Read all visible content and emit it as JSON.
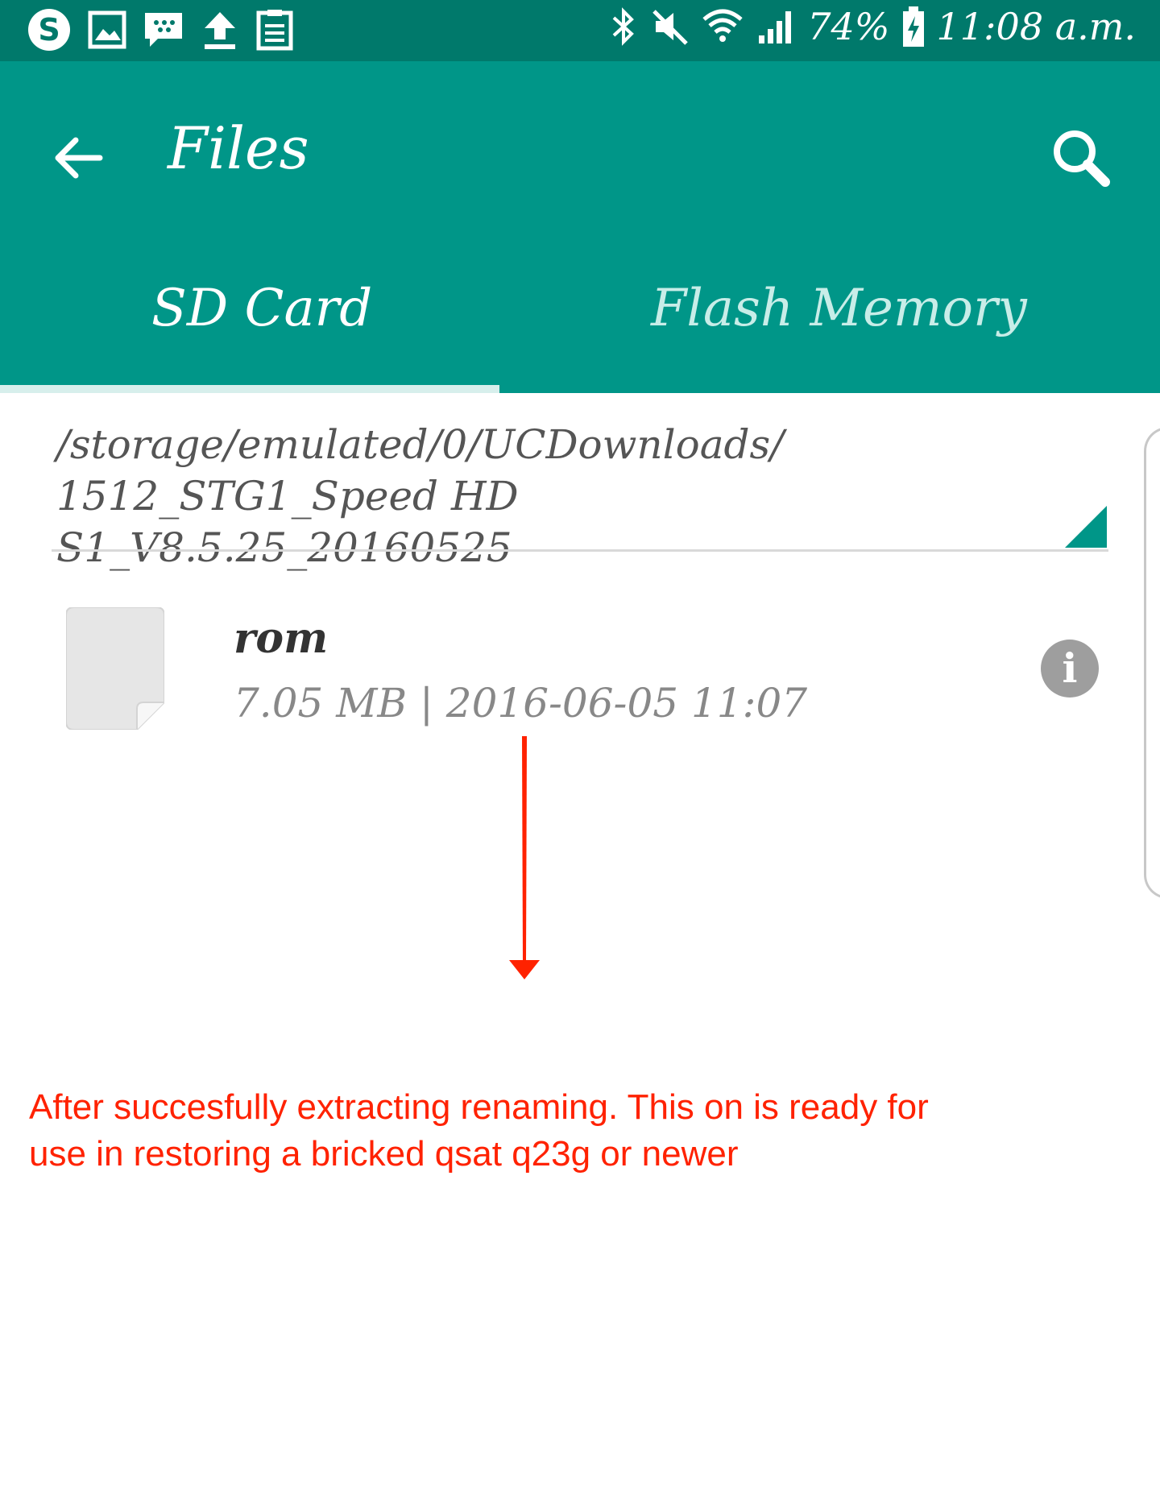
{
  "status_bar": {
    "battery": "74%",
    "time": "11:08 a.m."
  },
  "app_bar": {
    "title": "Files"
  },
  "tabs": [
    {
      "label": "SD Card",
      "selected": true
    },
    {
      "label": "Flash Memory",
      "selected": false
    }
  ],
  "path": {
    "line1": "/storage/emulated/0/UCDownloads/",
    "line2": "1512_STG1_Speed HD S1_V8.5.25_20160525"
  },
  "files": [
    {
      "name": "rom",
      "meta": "7.05 MB | 2016-06-05 11:07"
    }
  ],
  "annotation": {
    "line1": "After succesfully extracting renaming. This on is ready for",
    "line2": "use in restoring a bricked qsat q23g or newer"
  },
  "colors": {
    "status_bar": "#00796b",
    "app_bar": "#009688",
    "annotation": "#ff2200"
  }
}
